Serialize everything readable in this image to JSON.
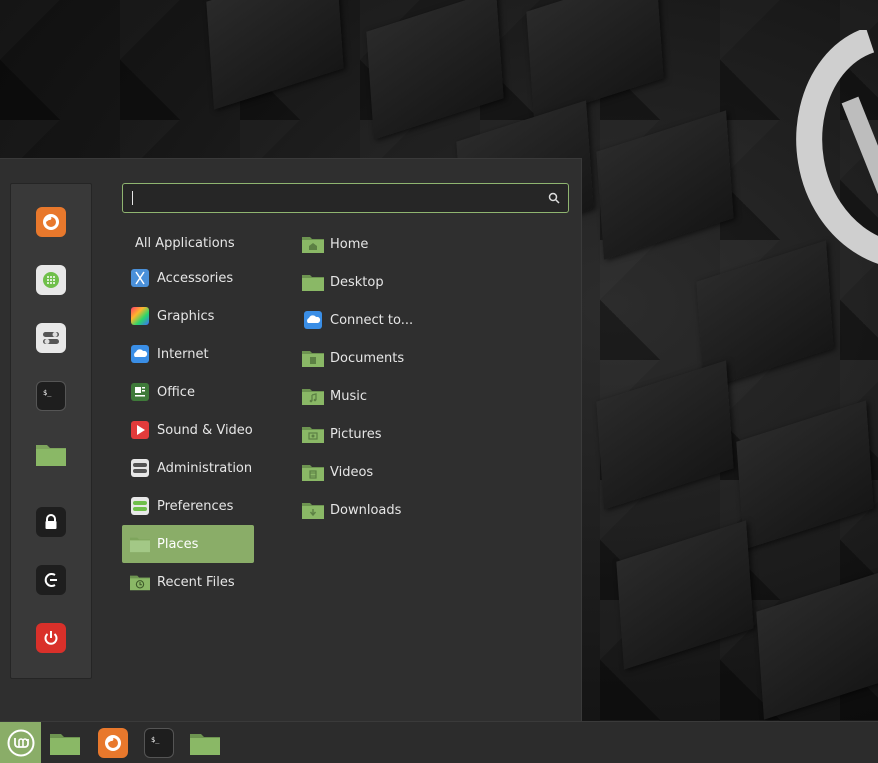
{
  "search": {
    "placeholder": "",
    "value": ""
  },
  "favorites": [
    {
      "name": "firefox-icon"
    },
    {
      "name": "software-manager-icon"
    },
    {
      "name": "system-settings-icon"
    },
    {
      "name": "terminal-icon"
    },
    {
      "name": "files-icon"
    },
    {
      "name": "lock-screen-icon"
    },
    {
      "name": "logout-icon"
    },
    {
      "name": "shutdown-icon"
    }
  ],
  "categories": [
    {
      "label": "All Applications",
      "icon": "none"
    },
    {
      "label": "Accessories",
      "icon": "accessories-icon"
    },
    {
      "label": "Graphics",
      "icon": "graphics-icon"
    },
    {
      "label": "Internet",
      "icon": "internet-icon"
    },
    {
      "label": "Office",
      "icon": "office-icon"
    },
    {
      "label": "Sound & Video",
      "icon": "sound-video-icon"
    },
    {
      "label": "Administration",
      "icon": "administration-icon"
    },
    {
      "label": "Preferences",
      "icon": "preferences-icon"
    },
    {
      "label": "Places",
      "icon": "folder-icon",
      "selected": true
    },
    {
      "label": "Recent Files",
      "icon": "recent-files-icon"
    }
  ],
  "places": [
    {
      "label": "Home",
      "icon": "home-folder-icon"
    },
    {
      "label": "Desktop",
      "icon": "desktop-folder-icon"
    },
    {
      "label": "Connect to...",
      "icon": "cloud-icon"
    },
    {
      "label": "Documents",
      "icon": "documents-folder-icon"
    },
    {
      "label": "Music",
      "icon": "music-folder-icon"
    },
    {
      "label": "Pictures",
      "icon": "pictures-folder-icon"
    },
    {
      "label": "Videos",
      "icon": "videos-folder-icon"
    },
    {
      "label": "Downloads",
      "icon": "downloads-folder-icon"
    }
  ],
  "taskbar": [
    {
      "name": "menu-start-icon"
    },
    {
      "name": "show-desktop-icon"
    },
    {
      "name": "firefox-icon"
    },
    {
      "name": "terminal-icon"
    },
    {
      "name": "files-icon"
    }
  ],
  "colors": {
    "accent": "#8aad68",
    "menu_bg": "#2f2f2f",
    "favbar_bg": "#393939",
    "text": "#e6e6e6"
  }
}
